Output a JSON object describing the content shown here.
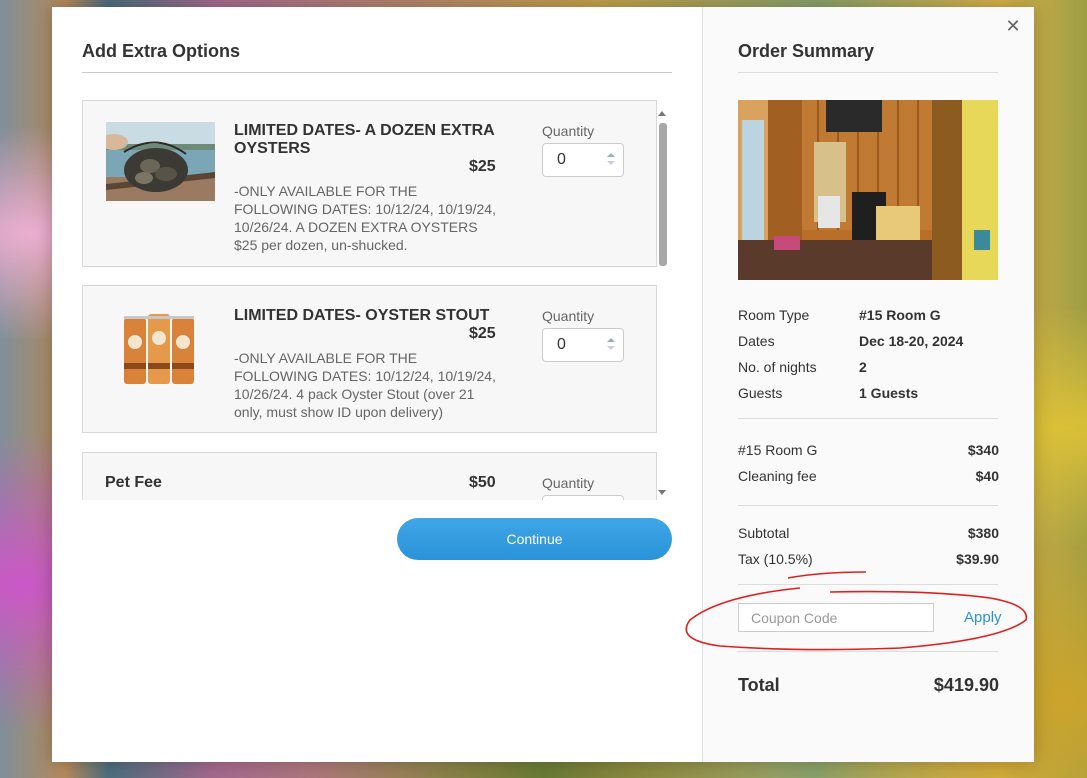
{
  "extras": {
    "title": "Add Extra Options",
    "items": [
      {
        "title": "LIMITED DATES- A DOZEN EXTRA OYSTERS",
        "price": "$25",
        "description": "-ONLY AVAILABLE FOR THE FOLLOWING DATES: 10/12/24, 10/19/24, 10/26/24. A DOZEN EXTRA OYSTERS $25 per dozen, un-shucked.",
        "quantity_label": "Quantity",
        "quantity": "0",
        "image": "oysters-in-net-photo"
      },
      {
        "title": "LIMITED DATES- OYSTER STOUT",
        "price": "$25",
        "description": "-ONLY AVAILABLE FOR THE FOLLOWING DATES: 10/12/24, 10/19/24, 10/26/24. 4 pack Oyster Stout (over 21 only, must show ID upon delivery)",
        "quantity_label": "Quantity",
        "quantity": "0",
        "image": "beer-cans-photo"
      },
      {
        "title": "Pet Fee",
        "price": "$50",
        "quantity_label": "Quantity"
      }
    ],
    "continue_label": "Continue"
  },
  "summary": {
    "title": "Order Summary",
    "details": [
      {
        "label": "Room Type",
        "value": "#15 Room G"
      },
      {
        "label": "Dates",
        "value": "Dec 18-20, 2024"
      },
      {
        "label": "No. of nights",
        "value": "2"
      },
      {
        "label": "Guests",
        "value": "1 Guests"
      }
    ],
    "charges": [
      {
        "label": "#15 Room G",
        "value": "$340"
      },
      {
        "label": "Cleaning fee",
        "value": "$40"
      }
    ],
    "subtotal_label": "Subtotal",
    "subtotal_value": "$380",
    "tax_label": "Tax (10.5%)",
    "tax_value": "$39.90",
    "coupon_placeholder": "Coupon Code",
    "apply_label": "Apply",
    "total_label": "Total",
    "total_value": "$419.90"
  },
  "close_icon": "close-icon",
  "colors": {
    "accent": "#2a93d8",
    "annotation": "#e02020"
  }
}
